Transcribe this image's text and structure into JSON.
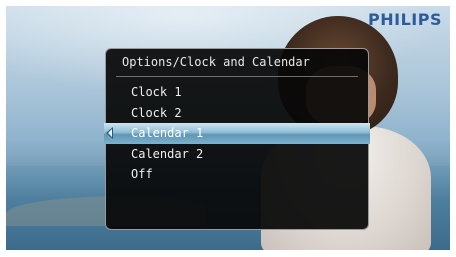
{
  "brand": {
    "logo": "PHILIPS"
  },
  "menu": {
    "title": "Options/Clock and Calendar",
    "items": [
      {
        "label": "Clock 1"
      },
      {
        "label": "Clock 2"
      },
      {
        "label": "Calendar 1",
        "selected": true
      },
      {
        "label": "Calendar 2"
      },
      {
        "label": "Off"
      }
    ]
  },
  "colors": {
    "logo": "#2e5c9a",
    "menu_bg": "#080808",
    "highlight": "#8fbcd4"
  }
}
